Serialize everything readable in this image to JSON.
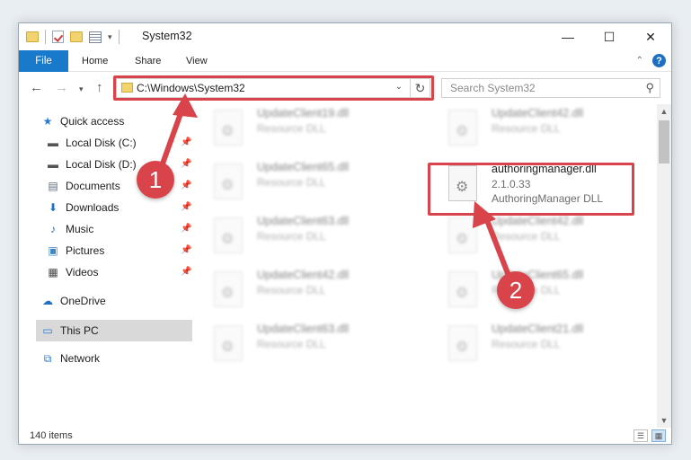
{
  "window": {
    "title": "System32",
    "controls": {
      "minimize": "—",
      "maximize": "☐",
      "close": "✕"
    }
  },
  "ribbon": {
    "tabs": [
      "File",
      "Home",
      "Share",
      "View"
    ]
  },
  "navigation": {
    "address": "C:\\Windows\\System32",
    "search_placeholder": "Search System32"
  },
  "sidebar": {
    "items": [
      {
        "label": "Quick access",
        "icon": "star-icon",
        "pinned": false
      },
      {
        "label": "Local Disk (C:)",
        "icon": "drive-icon",
        "pinned": true
      },
      {
        "label": "Local Disk (D:)",
        "icon": "drive-icon",
        "pinned": true
      },
      {
        "label": "Documents",
        "icon": "documents-icon",
        "pinned": true
      },
      {
        "label": "Downloads",
        "icon": "downloads-icon",
        "pinned": true
      },
      {
        "label": "Music",
        "icon": "music-icon",
        "pinned": true
      },
      {
        "label": "Pictures",
        "icon": "pictures-icon",
        "pinned": true
      },
      {
        "label": "Videos",
        "icon": "videos-icon",
        "pinned": true
      },
      {
        "label": "OneDrive",
        "icon": "cloud-icon",
        "pinned": false
      },
      {
        "label": "This PC",
        "icon": "computer-icon",
        "pinned": false,
        "selected": true
      },
      {
        "label": "Network",
        "icon": "network-icon",
        "pinned": false
      }
    ]
  },
  "files": {
    "left": [
      {
        "name": "UpdateClient19.dll",
        "type": "Resource DLL"
      },
      {
        "name": "UpdateClient65.dll",
        "type": "Resource DLL"
      },
      {
        "name": "UpdateClient63.dll",
        "type": "Resource DLL"
      },
      {
        "name": "UpdateClient42.dll",
        "type": "Resource DLL"
      },
      {
        "name": "UpdateClient63.dll",
        "type": "Resource DLL"
      }
    ],
    "right": [
      {
        "name": "UpdateClient42.dll",
        "type": "Resource DLL"
      },
      {
        "name": "UpdateClient42.dll",
        "type": "Resource DLL"
      },
      {
        "name": "UpdateClient65.dll",
        "type": "Resource DLL"
      },
      {
        "name": "UpdateClient21.dll",
        "type": "Resource DLL"
      }
    ],
    "highlighted": {
      "name": "authoringmanager.dll",
      "version": "2.1.0.33",
      "description": "AuthoringManager DLL"
    }
  },
  "status": {
    "item_count": "140 items"
  },
  "annotations": {
    "callout_1": "1",
    "callout_2": "2",
    "color": "#d9434a"
  }
}
